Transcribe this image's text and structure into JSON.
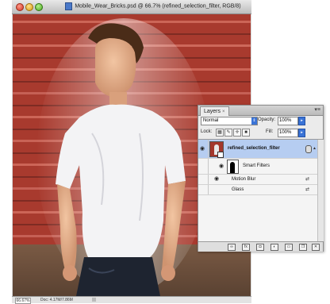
{
  "document": {
    "title": "Mobile_Wear_Bricks.psd @ 66.7% (refined_selection_filter, RGB/8)",
    "zoom": "66.67%",
    "doc_size": "Doc: 4.17M/7.86M"
  },
  "layers_panel": {
    "tab_label": "Layers",
    "tab_close": "×",
    "blend_mode": "Normal",
    "opacity_label": "Opacity:",
    "opacity_value": "100%",
    "lock_label": "Lock:",
    "fill_label": "Fill:",
    "fill_value": "100%",
    "layers": [
      {
        "name": "refined_selection_filter",
        "smart_filters_label": "Smart Filters",
        "filters": [
          "Motion Blur",
          "Glass"
        ]
      }
    ]
  },
  "colors": {
    "selection_highlight": "#b6cdf1",
    "brick_red": "#a83a2e",
    "accent_blue": "#3a73d6"
  },
  "icons": {
    "eye": "eye-icon",
    "filter_options": "filter-options-icon",
    "panel_menu": "panel-menu-icon"
  }
}
